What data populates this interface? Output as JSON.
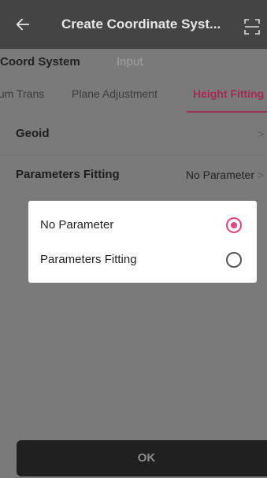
{
  "titlebar": {
    "title": "Create Coordinate Syst...",
    "back_icon": "back-arrow-icon",
    "scan_icon": "scan-frame-icon"
  },
  "section_tabs": {
    "active": "Coord System",
    "inactive": "Input"
  },
  "sub_tabs": {
    "items": [
      "tum Trans",
      "Plane Adjustment",
      "Height Fitting"
    ],
    "active_index": 2
  },
  "rows": [
    {
      "label": "Geoid",
      "value": "",
      "arrow": ">"
    },
    {
      "label": "Parameters Fitting",
      "value": "No Parameter",
      "arrow": ">"
    }
  ],
  "ok_button": {
    "label": "OK"
  },
  "dialog": {
    "options": [
      {
        "label": "No Parameter",
        "selected": true
      },
      {
        "label": "Parameters Fitting",
        "selected": false
      }
    ]
  },
  "colors": {
    "accent": "#e0457b",
    "tab_active": "#a32c55",
    "titlebar_bg": "#444444",
    "overlay_bg": "#7a7a7a"
  }
}
